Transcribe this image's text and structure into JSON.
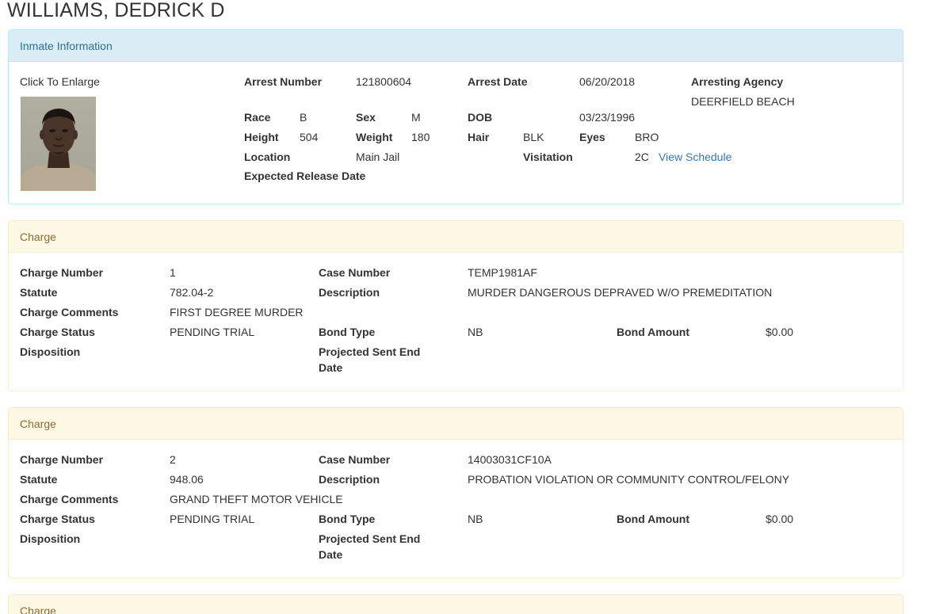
{
  "page": {
    "title": "WILLIAMS, DEDRICK D"
  },
  "inmate": {
    "heading": "Inmate Information",
    "photo_caption": "Click To Enlarge",
    "labels": {
      "arrest_number": "Arrest Number",
      "arrest_date": "Arrest Date",
      "arresting_agency": "Arresting Agency",
      "race": "Race",
      "sex": "Sex",
      "dob": "DOB",
      "height": "Height",
      "weight": "Weight",
      "hair": "Hair",
      "eyes": "Eyes",
      "location": "Location",
      "visitation": "Visitation",
      "expected_release": "Expected Release Date"
    },
    "values": {
      "arrest_number": "121800604",
      "arrest_date": "06/20/2018",
      "arresting_agency": "DEERFIELD BEACH",
      "race": "B",
      "sex": "M",
      "dob": "03/23/1996",
      "height": "504",
      "weight": "180",
      "hair": "BLK",
      "eyes": "BRO",
      "location": "Main Jail",
      "visitation": "2C",
      "view_schedule": "View Schedule"
    }
  },
  "charge_labels": {
    "heading": "Charge",
    "charge_number": "Charge Number",
    "case_number": "Case Number",
    "statute": "Statute",
    "description": "Description",
    "charge_comments": "Charge Comments",
    "charge_status": "Charge Status",
    "bond_type": "Bond Type",
    "bond_amount": "Bond Amount",
    "disposition": "Disposition",
    "projected_line1": "Projected Sent End",
    "projected_line2": "Date"
  },
  "charges": [
    {
      "charge_number": "1",
      "case_number": "TEMP1981AF",
      "statute": "782.04-2",
      "description": "MURDER DANGEROUS DEPRAVED W/O PREMEDITATION",
      "charge_comments": "FIRST DEGREE MURDER",
      "charge_status": "PENDING TRIAL",
      "bond_type": "NB",
      "bond_amount": "$0.00"
    },
    {
      "charge_number": "2",
      "case_number": "14003031CF10A",
      "statute": "948.06",
      "description": "PROBATION VIOLATION OR COMMUNITY CONTROL/FELONY",
      "charge_comments": "GRAND THEFT MOTOR VEHICLE",
      "charge_status": "PENDING TRIAL",
      "bond_type": "NB",
      "bond_amount": "$0.00"
    }
  ],
  "colors": {
    "info_heading_bg": "#d9edf7",
    "info_heading_text": "#31708f",
    "warn_heading_bg": "#fcf8e3",
    "warn_heading_text": "#8a6d3b",
    "link": "#337ab7"
  }
}
